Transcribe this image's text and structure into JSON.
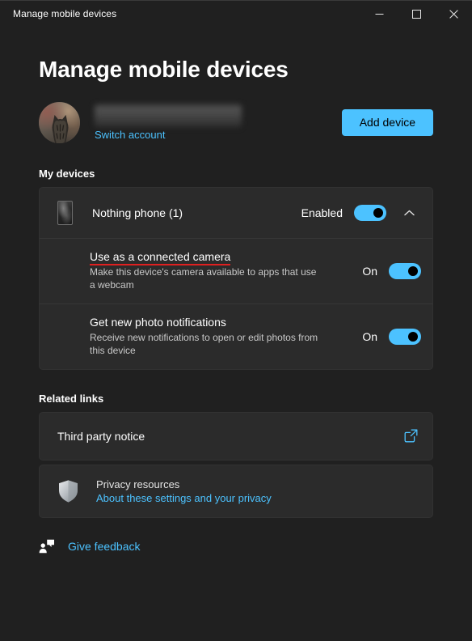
{
  "window": {
    "title": "Manage mobile devices",
    "controls": {
      "minimize": "minimize-icon",
      "maximize": "maximize-icon",
      "close": "close-icon"
    }
  },
  "page": {
    "title": "Manage mobile devices"
  },
  "account": {
    "avatar_alt": "cat-avatar",
    "name": "",
    "name_redacted": true,
    "switch_account_label": "Switch account",
    "add_device_label": "Add device"
  },
  "my_devices": {
    "heading": "My devices",
    "device": {
      "name": "Nothing phone (1)",
      "thumbnail_alt": "phone-thumbnail",
      "state_label": "Enabled",
      "toggle_on": true,
      "expanded": true,
      "settings": [
        {
          "title": "Use as a connected camera",
          "description": "Make this device's camera available to apps that use a webcam",
          "state_label": "On",
          "toggle_on": true,
          "annotated": true
        },
        {
          "title": "Get new photo notifications",
          "description": "Receive new notifications to open or edit photos from this device",
          "state_label": "On",
          "toggle_on": true,
          "annotated": false
        }
      ]
    }
  },
  "related_links": {
    "heading": "Related links",
    "third_party_notice": {
      "label": "Third party notice",
      "icon": "external-link-icon"
    },
    "privacy": {
      "icon": "shield-icon",
      "title": "Privacy resources",
      "link_label": "About these settings and your privacy"
    }
  },
  "feedback": {
    "icon": "feedback-person-icon",
    "label": "Give feedback"
  },
  "colors": {
    "accent": "#4cc2ff",
    "page_background": "#202020",
    "card_background": "#2b2b2b",
    "annotation_red": "#e02020",
    "button_text": "#000000"
  }
}
